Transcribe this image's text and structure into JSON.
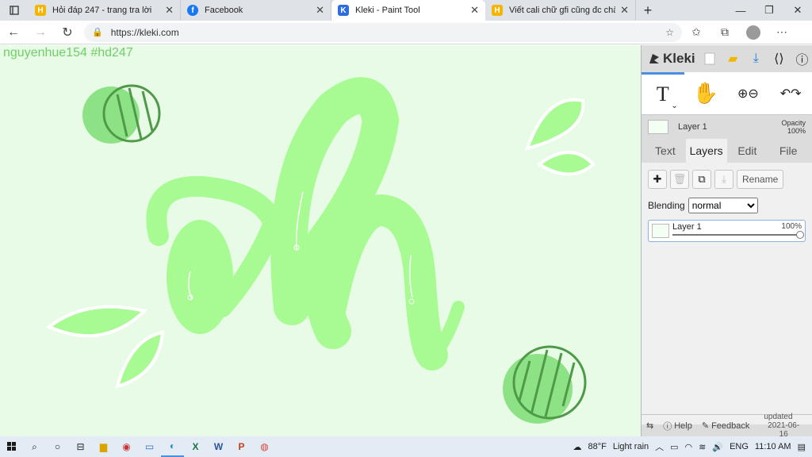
{
  "browser": {
    "tabs": [
      {
        "title": "Hỏi đáp 247 - trang tra lời",
        "favicon": "H"
      },
      {
        "title": "Facebook",
        "favicon": "f"
      },
      {
        "title": "Kleki - Paint Tool",
        "favicon": "K"
      },
      {
        "title": "Viết cali chữ gfi cũng đc chẳng h",
        "favicon": "H"
      }
    ],
    "url": "https://kleki.com",
    "window_controls": [
      "minimize",
      "restore",
      "close"
    ]
  },
  "canvas": {
    "signature": "nguyenhue154 #hd247",
    "background": "#e8fbe6",
    "ink": "#a8fb92"
  },
  "kleki": {
    "logo": "Kleki",
    "tool_label": "T",
    "current_layer": "Layer 1",
    "opacity_label": "Opacity",
    "opacity_value": "100%",
    "tabs": [
      "Text",
      "Layers",
      "Edit",
      "File"
    ],
    "active_tab": "Layers",
    "rename_label": "Rename",
    "blending_label": "Blending",
    "blending_value": "normal",
    "layers": [
      {
        "name": "Layer 1",
        "opacity": "100%",
        "opacity_fraction": 1.0
      }
    ],
    "footer": {
      "help": "Help",
      "feedback": "Feedback",
      "updated_label": "updated",
      "updated_date": "2021-06-16"
    }
  },
  "taskbar": {
    "weather_temp": "88°F",
    "weather_text": "Light rain",
    "lang": "ENG",
    "time": "11:10 AM"
  }
}
